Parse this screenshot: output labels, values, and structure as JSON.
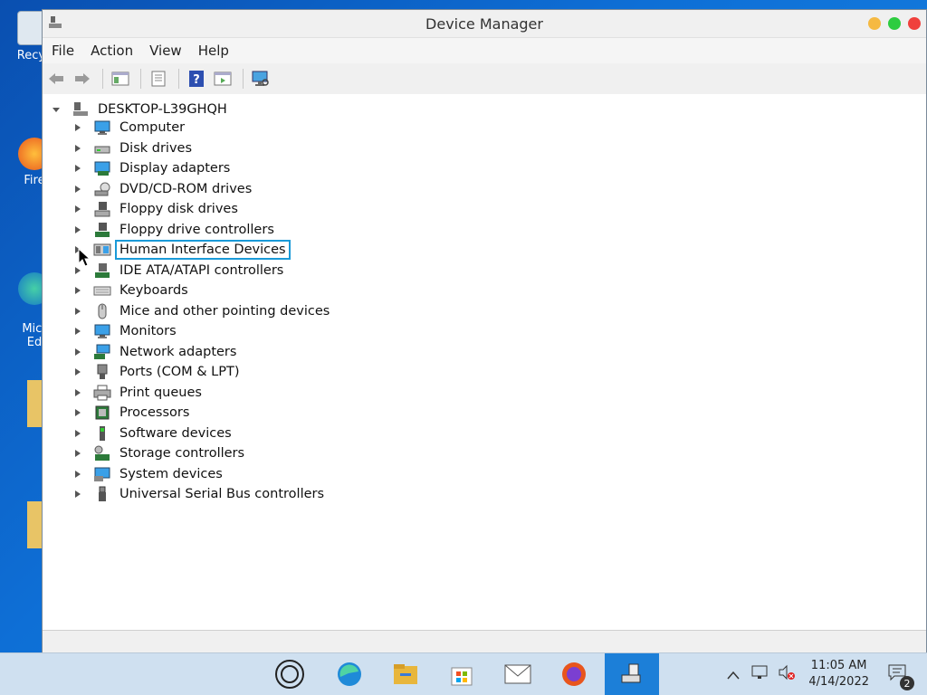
{
  "desktop": {
    "icons": [
      {
        "label": "Recyc",
        "icon": "recycle-bin-icon"
      },
      {
        "label": "Fire",
        "icon": "firefox-icon"
      },
      {
        "label": "Micr\nEd",
        "icon": "edge-icon"
      }
    ]
  },
  "window": {
    "title": "Device Manager",
    "menu": [
      "File",
      "Action",
      "View",
      "Help"
    ],
    "root": "DESKTOP-L39GHQH",
    "devices": [
      {
        "label": "Computer",
        "icon": "computer-icon"
      },
      {
        "label": "Disk drives",
        "icon": "disk-drive-icon"
      },
      {
        "label": "Display adapters",
        "icon": "display-adapter-icon"
      },
      {
        "label": "DVD/CD-ROM drives",
        "icon": "dvd-drive-icon"
      },
      {
        "label": "Floppy disk drives",
        "icon": "floppy-drive-icon"
      },
      {
        "label": "Floppy drive controllers",
        "icon": "floppy-controller-icon"
      },
      {
        "label": "Human Interface Devices",
        "icon": "hid-icon",
        "selected": true
      },
      {
        "label": "IDE ATA/ATAPI controllers",
        "icon": "ide-controller-icon"
      },
      {
        "label": "Keyboards",
        "icon": "keyboard-icon"
      },
      {
        "label": "Mice and other pointing devices",
        "icon": "mouse-icon"
      },
      {
        "label": "Monitors",
        "icon": "monitor-icon"
      },
      {
        "label": "Network adapters",
        "icon": "network-adapter-icon"
      },
      {
        "label": "Ports (COM & LPT)",
        "icon": "port-icon"
      },
      {
        "label": "Print queues",
        "icon": "printer-icon"
      },
      {
        "label": "Processors",
        "icon": "processor-icon"
      },
      {
        "label": "Software devices",
        "icon": "software-device-icon"
      },
      {
        "label": "Storage controllers",
        "icon": "storage-controller-icon"
      },
      {
        "label": "System devices",
        "icon": "system-device-icon"
      },
      {
        "label": "Universal Serial Bus controllers",
        "icon": "usb-icon"
      }
    ]
  },
  "taskbar": {
    "time": "11:05 AM",
    "date": "4/14/2022",
    "notification_count": "2"
  },
  "colors": {
    "selection_outline": "#1a9ad8",
    "taskbar_active": "#1c7fd8",
    "traffic_yellow": "#f5b942",
    "traffic_green": "#2ecc40",
    "traffic_red": "#f0403c"
  }
}
